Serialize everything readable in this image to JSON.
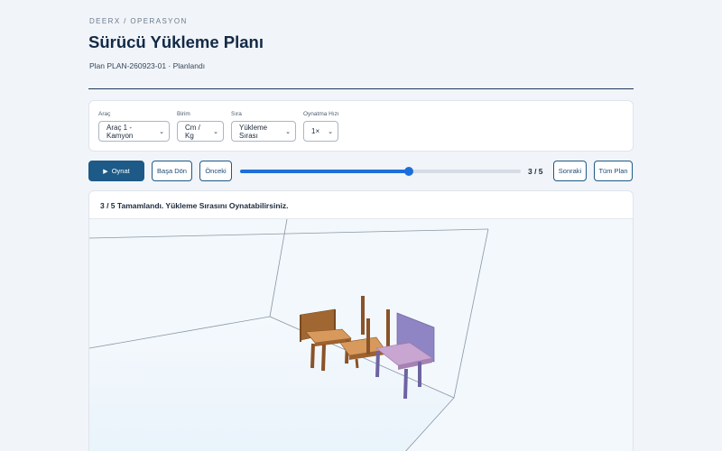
{
  "breadcrumb": "DEERX / OPERASYON",
  "page_title": "Sürücü Yükleme Planı",
  "plan_meta": "Plan PLAN-260923-01 · Planlandı",
  "filters": {
    "vehicle": {
      "label": "Araç",
      "value": "Araç 1 - Kamyon"
    },
    "unit": {
      "label": "Birim",
      "value": "Cm / Kg"
    },
    "order": {
      "label": "Sıra",
      "value": "Yükleme Sırası"
    },
    "speed": {
      "label": "Oynatma Hızı",
      "value": "1×"
    }
  },
  "controls": {
    "play": "Oynat",
    "reset": "Başa Dön",
    "prev": "Önceki",
    "next": "Sonraki",
    "all": "Tüm Plan",
    "step_text": "3 / 5",
    "progress": 0.6
  },
  "viewer": {
    "status": "3 / 5 Tamamlandı. Yükleme Sırasını Oynatabilirsiniz."
  },
  "colors": {
    "primary": "#1d5a87",
    "slider": "#1d6fd8",
    "wood": "#c8874e",
    "wood_dark": "#8a5328",
    "chair_purple": "#8f85c4",
    "chair_pink": "#c9a5d2"
  }
}
